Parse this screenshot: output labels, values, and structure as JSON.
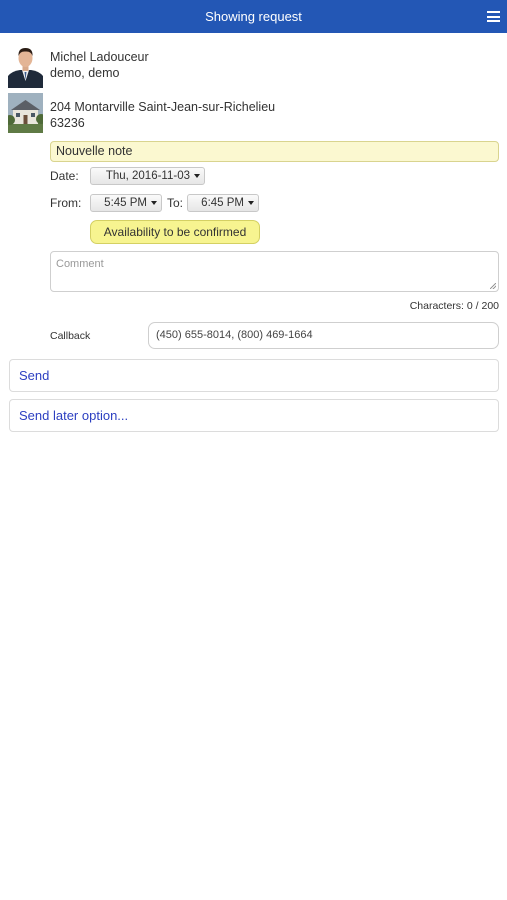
{
  "header": {
    "title": "Showing request",
    "menu_icon": "hamburger-menu-icon"
  },
  "agent": {
    "name": "Michel Ladouceur",
    "company": "demo, demo",
    "photo_icon": "agent-photo"
  },
  "property": {
    "address": "204 Montarville Saint-Jean-sur-Richelieu",
    "listing_number": "63236",
    "photo_icon": "house-photo"
  },
  "note": {
    "value": "Nouvelle note"
  },
  "date": {
    "label": "Date:",
    "value": "Thu, 2016-11-03"
  },
  "time": {
    "from_label": "From:",
    "from_value": "5:45 PM",
    "to_label": "To:",
    "to_value": "6:45 PM"
  },
  "availability": {
    "label": "Availability to be confirmed"
  },
  "comment": {
    "placeholder": "Comment",
    "counter": "Characters: 0 / 200"
  },
  "callback": {
    "label": "Callback",
    "value": "(450) 655-8014, (800) 469-1664"
  },
  "actions": {
    "send": "Send",
    "send_later": "Send later option..."
  },
  "colors": {
    "header_bg": "#2357b5",
    "note_bg": "#fbf8d0",
    "availability_bg": "#f7f490",
    "link": "#2c3fc1"
  }
}
